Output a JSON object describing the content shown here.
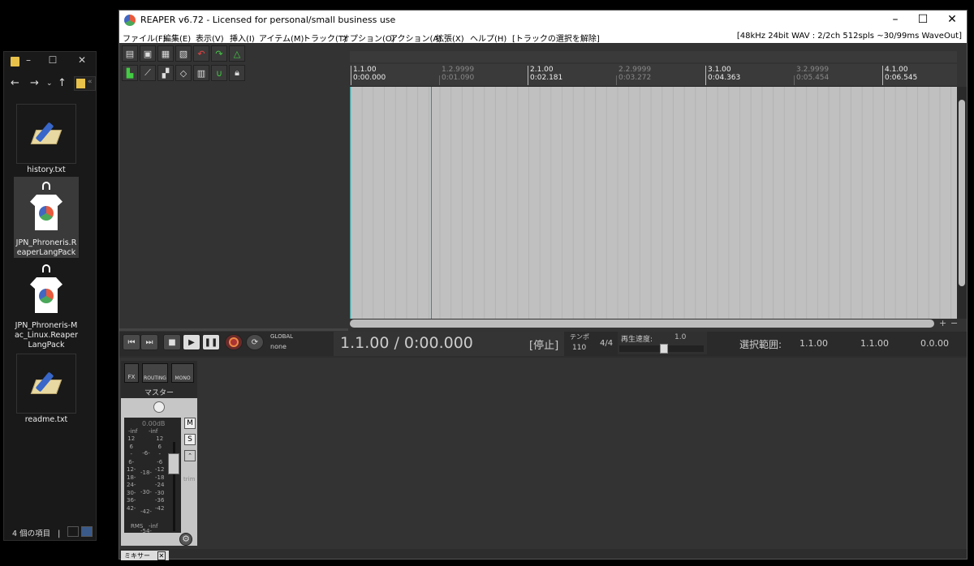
{
  "explorer": {
    "items": [
      {
        "name": "history.txt",
        "kind": "notepad-icon"
      },
      {
        "name": "JPN_Phroneris.ReaperLangPack",
        "kind": "shirt-icon"
      },
      {
        "name": "JPN_Phroneris-Mac_Linux.ReaperLangPack",
        "kind": "shirt-icon"
      },
      {
        "name": "readme.txt",
        "kind": "notepad-icon"
      }
    ],
    "status": "4 個の項目",
    "status_sep": "|"
  },
  "reaper": {
    "title": "REAPER v6.72 - Licensed for personal/small business use",
    "menu": [
      "ファイル(F)",
      "編集(E)",
      "表示(V)",
      "挿入(I)",
      "アイテム(M)",
      "トラック(T)",
      "オプション(O)",
      "アクション(A)",
      "拡張(X)",
      "ヘルプ(H)",
      "[トラックの選択を解除]"
    ],
    "status": "[48kHz 24bit WAV : 2/2ch 512spls ~30/99ms WaveOut]",
    "ruler": [
      {
        "bar": "1.1.00",
        "time": "0:00.000",
        "major": true
      },
      {
        "bar": "1.2.9999",
        "time": "0:01.090",
        "major": false
      },
      {
        "bar": "2.1.00",
        "time": "0:02.181",
        "major": true
      },
      {
        "bar": "2.2.9999",
        "time": "0:03.272",
        "major": false
      },
      {
        "bar": "3.1.00",
        "time": "0:04.363",
        "major": true
      },
      {
        "bar": "3.2.9999",
        "time": "0:05.454",
        "major": false
      },
      {
        "bar": "4.1.00",
        "time": "0:06.545",
        "major": true
      }
    ],
    "transport": {
      "global": "GLOBAL",
      "none": "none",
      "time": "1.1.00 / 0:00.000",
      "state": "[停止]",
      "tempo_label": "テンポ",
      "tempo": "110",
      "signature": "4/4",
      "rate_label": "再生速度:",
      "rate": "1.0",
      "selection_label": "選択範囲:",
      "sel_start": "1.1.00",
      "sel_end": "1.1.00",
      "sel_len": "0.0.00"
    },
    "mixer": {
      "fx": "FX",
      "routing": "ROUTING",
      "mono": "MONO",
      "master_name": "マスター",
      "db": "0.00dB",
      "inf_left": "-inf",
      "inf_right": "-inf",
      "scale_left": [
        "12",
        "6",
        "-",
        "6-",
        "12-",
        "18-",
        "24-",
        "30-",
        "36-",
        "42-"
      ],
      "scale_mid": [
        "-6-",
        "-18-",
        "-30-",
        "-42-",
        "-54-"
      ],
      "scale_right": [
        "12",
        "6",
        "-",
        "-6",
        "-12",
        "-18",
        "-24",
        "-30",
        "-36",
        "-42"
      ],
      "rms": "RMS",
      "rms_val": "-inf",
      "mute": "M",
      "solo": "S",
      "trim": "trim",
      "tab": "ミキサー"
    }
  }
}
